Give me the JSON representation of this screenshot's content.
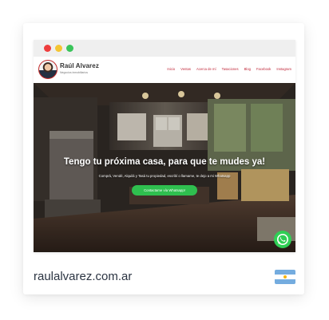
{
  "window": {
    "controls": [
      "close-dot",
      "minimize-dot",
      "maximize-dot"
    ]
  },
  "site": {
    "brand_name": "Raúl Alvarez",
    "brand_tagline": "Negocios inmobiliarios",
    "nav": [
      "Inicio",
      "Ventas",
      "Acerca de mí",
      "Tasaciones",
      "Blog",
      "Facebook",
      "Instagram"
    ],
    "hero": {
      "headline": "Tengo tu próxima casa, para que te mudes ya!",
      "subheadline": "Comprá, Vendé, Alquilá y Tasá tu propiedad, escribí o llamame, te dejo a mi Whatsapp",
      "cta_label": "Contactame vía Whatsapp!"
    },
    "floating_button": "whatsapp-icon"
  },
  "caption": {
    "domain": "raulalvarez.com.ar",
    "flag": "argentina-flag-icon"
  },
  "colors": {
    "accent_red": "#c0283a",
    "whatsapp_green": "#2fbf4f",
    "flag_blue": "#74acdf",
    "text_dark": "#2b3442"
  }
}
